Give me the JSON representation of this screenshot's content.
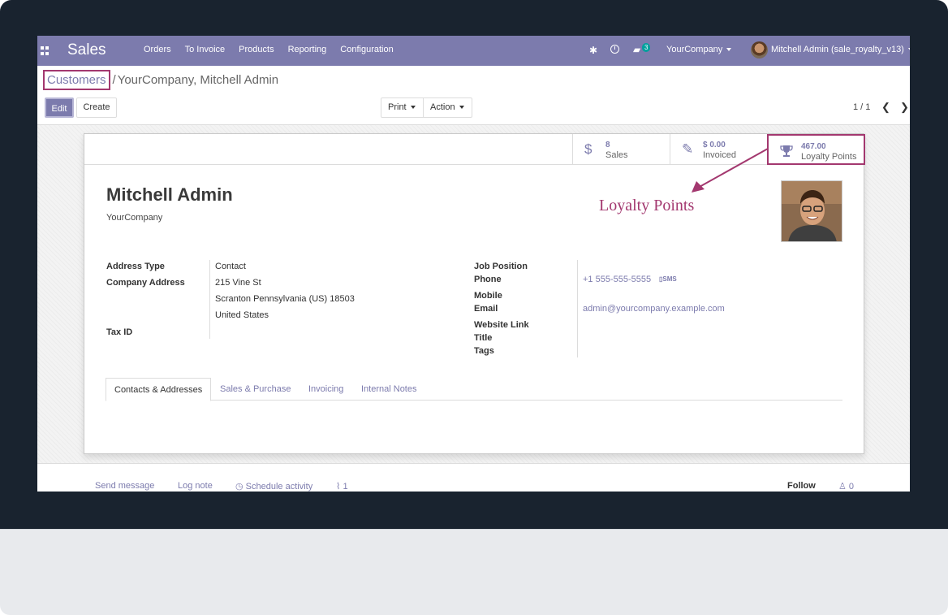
{
  "navbar": {
    "app_name": "Sales",
    "menu": [
      "Orders",
      "To Invoice",
      "Products",
      "Reporting",
      "Configuration"
    ],
    "messages_badge": "3",
    "company": "YourCompany",
    "user": "Mitchell Admin (sale_royalty_v13)",
    "color": "#7c7bad"
  },
  "breadcrumb": {
    "parent": "Customers",
    "separator": "/",
    "current": "YourCompany, Mitchell Admin"
  },
  "toolbar": {
    "edit": "Edit",
    "create": "Create",
    "print": "Print",
    "action": "Action",
    "pager": "1 / 1"
  },
  "stats": {
    "sales": {
      "value": "8",
      "label": "Sales"
    },
    "invoiced": {
      "value": "$ 0.00",
      "label": "Invoiced"
    },
    "loyalty": {
      "value": "467.00",
      "label": "Loyalty Points"
    }
  },
  "annotation": "Loyalty Points",
  "partner": {
    "name": "Mitchell Admin",
    "company": "YourCompany",
    "fields_left": {
      "address_type_label": "Address Type",
      "address_type": "Contact",
      "company_address_label": "Company Address",
      "street": "215 Vine St",
      "city_line": "Scranton  Pennsylvania (US)  18503",
      "country": "United States",
      "tax_id_label": "Tax ID"
    },
    "fields_right": {
      "job_position_label": "Job Position",
      "phone_label": "Phone",
      "phone": "+1 555-555-5555",
      "sms": "SMS",
      "mobile_label": "Mobile",
      "email_label": "Email",
      "email": "admin@yourcompany.example.com",
      "website_label": "Website Link",
      "title_label": "Title",
      "tags_label": "Tags"
    }
  },
  "tabs": [
    "Contacts & Addresses",
    "Sales & Purchase",
    "Invoicing",
    "Internal Notes"
  ],
  "chatter": {
    "send_message": "Send message",
    "log_note": "Log note",
    "schedule_activity": "Schedule activity",
    "attachments": "1",
    "follow": "Follow",
    "followers": "0"
  },
  "accent_color": "#a3386f"
}
